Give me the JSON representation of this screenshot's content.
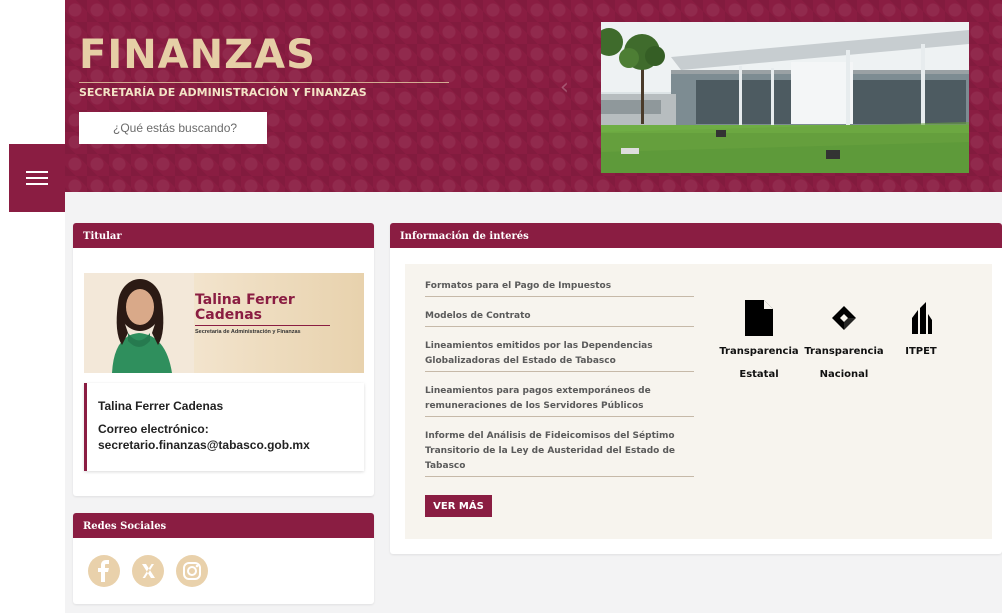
{
  "header": {
    "title": "FINANZAS",
    "subtitle": "SECRETARÍA DE ADMINISTRACIÓN Y FINANZAS",
    "search_placeholder": "¿Qué estás buscando?"
  },
  "titular": {
    "heading": "Titular",
    "banner_name": "Talina Ferrer Cadenas",
    "banner_role": "Secretaria de Administración y Finanzas",
    "name": "Talina Ferrer Cadenas",
    "email_label": "Correo electrónico:",
    "email": "secretario.finanzas@tabasco.gob.mx"
  },
  "redes": {
    "heading": "Redes Sociales",
    "icons": [
      "facebook-icon",
      "x-icon",
      "instagram-icon"
    ]
  },
  "interes": {
    "heading": "Información de interés",
    "links": [
      "Formatos para el Pago de Impuestos",
      "Modelos de Contrato",
      "Lineamientos emitidos por las Dependencias Globalizadoras del Estado de Tabasco",
      "Lineamientos para pagos extemporáneos de remuneraciones de los Servidores Públicos",
      "Informe del Análisis de Fideicomisos del Séptimo Transitorio de la Ley de Austeridad del Estado de Tabasco"
    ],
    "more_label": "VER MÁS",
    "quick_links": [
      {
        "label_1": "Transparencia",
        "label_2": "Estatal",
        "icon": "document-icon"
      },
      {
        "label_1": "Transparencia",
        "label_2": "Nacional",
        "icon": "transparencia-nacional-logo"
      },
      {
        "label_1": "ITPET",
        "label_2": "",
        "icon": "itpet-logo"
      }
    ]
  },
  "colors": {
    "brand": "#8a1d42",
    "gold": "#e6cfa6",
    "panel": "#f7f4ee"
  }
}
